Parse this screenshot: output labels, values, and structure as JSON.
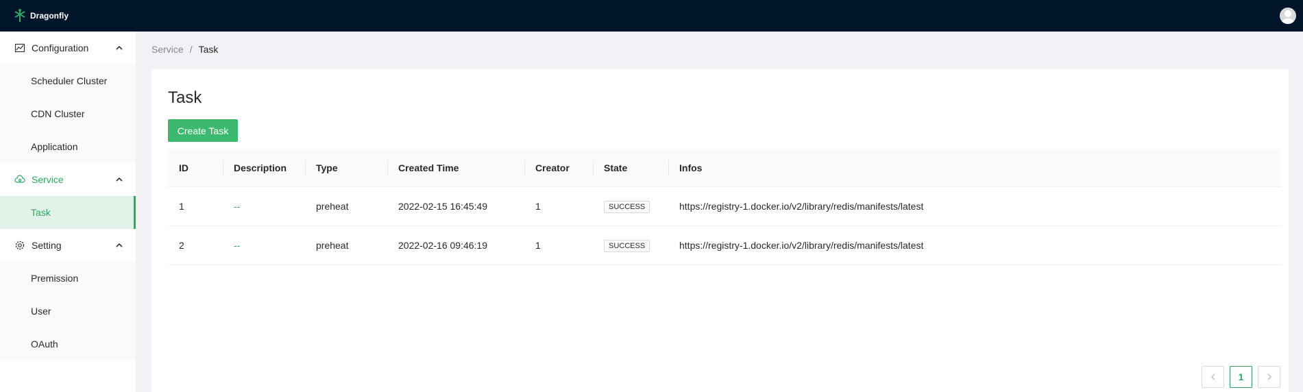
{
  "header": {
    "brand": "Dragonfly",
    "avatar_icon": "user-avatar-icon"
  },
  "sidebar": {
    "groups": [
      {
        "title": "Configuration",
        "icon": "line-chart-icon",
        "expanded": true,
        "active": false,
        "items": [
          {
            "label": "Scheduler Cluster"
          },
          {
            "label": "CDN Cluster"
          },
          {
            "label": "Application"
          }
        ]
      },
      {
        "title": "Service",
        "icon": "cloud-icon",
        "expanded": true,
        "active": true,
        "items": [
          {
            "label": "Task",
            "selected": true
          }
        ]
      },
      {
        "title": "Setting",
        "icon": "gear-icon",
        "expanded": true,
        "active": false,
        "items": [
          {
            "label": "Premission"
          },
          {
            "label": "User"
          },
          {
            "label": "OAuth"
          }
        ]
      }
    ]
  },
  "breadcrumb": {
    "parent": "Service",
    "separator": "/",
    "current": "Task"
  },
  "main": {
    "title": "Task",
    "create_button": "Create Task",
    "table": {
      "columns": [
        "ID",
        "Description",
        "Type",
        "Created Time",
        "Creator",
        "State",
        "Infos"
      ],
      "rows": [
        {
          "id": "1",
          "description": "--",
          "type": "preheat",
          "created_time": "2022-02-15 16:45:49",
          "creator": "1",
          "state": "SUCCESS",
          "infos": "https://registry-1.docker.io/v2/library/redis/manifests/latest"
        },
        {
          "id": "2",
          "description": "--",
          "type": "preheat",
          "created_time": "2022-02-16 09:46:19",
          "creator": "1",
          "state": "SUCCESS",
          "infos": "https://registry-1.docker.io/v2/library/redis/manifests/latest"
        }
      ]
    },
    "pagination": {
      "current_page": "1"
    }
  },
  "colors": {
    "primary": "#3cb96e",
    "accent": "#2fa562",
    "header_bg": "#001529"
  }
}
